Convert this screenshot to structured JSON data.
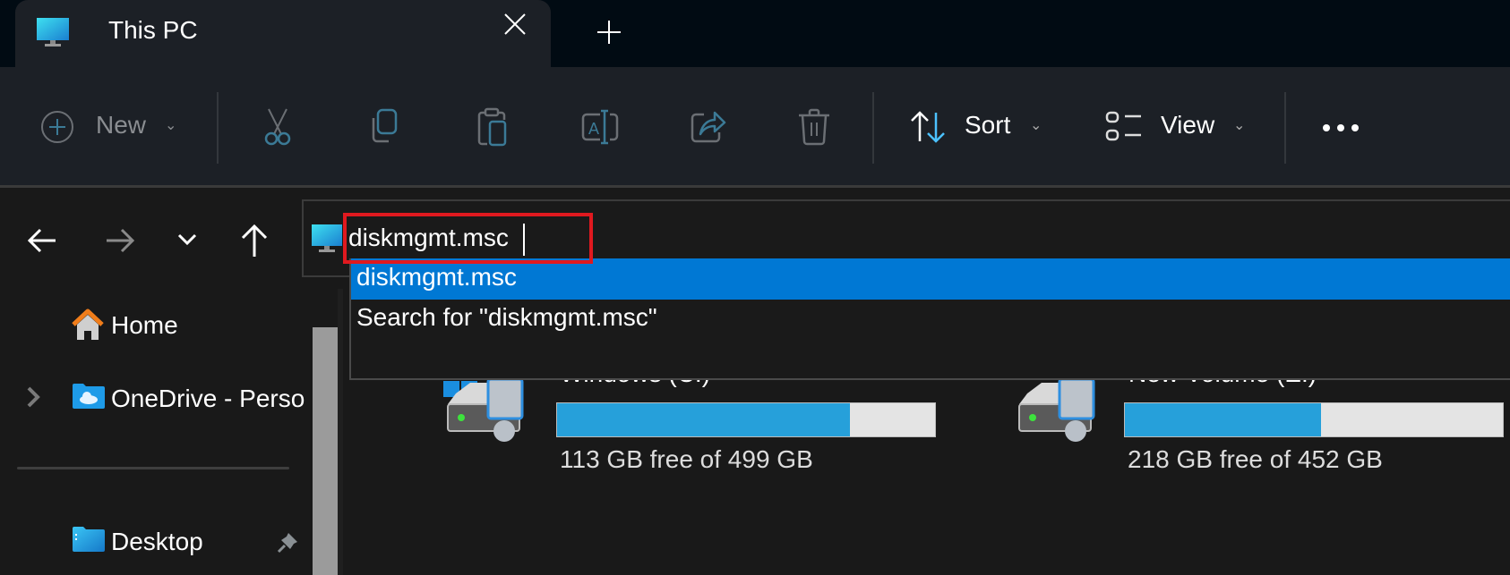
{
  "window": {
    "tab_title": "This PC",
    "tab_icon": "monitor-icon",
    "close_tab_icon": "close-icon",
    "new_tab_icon": "plus-icon"
  },
  "toolbar": {
    "new_label": "New",
    "sort_label": "Sort",
    "view_label": "View",
    "buttons": [
      "new",
      "cut",
      "copy",
      "paste",
      "rename",
      "share",
      "delete",
      "sort",
      "view",
      "more"
    ],
    "accent": "#4cc2ff"
  },
  "nav": {
    "buttons": [
      "back",
      "forward",
      "recent-locations",
      "up"
    ]
  },
  "address_bar": {
    "value": "diskmgmt.msc",
    "highlight_color": "#e0191f"
  },
  "autocomplete": {
    "items": [
      {
        "label": "diskmgmt.msc",
        "selected": true
      },
      {
        "label": "Search for \"diskmgmt.msc\"",
        "selected": false
      }
    ],
    "selected_color": "#0078d4"
  },
  "sidebar": {
    "items": [
      {
        "label": "Home",
        "icon": "home-icon"
      },
      {
        "label": "OneDrive - Perso",
        "icon": "onedrive-folder-icon",
        "expandable": true
      },
      {
        "label": "Desktop",
        "icon": "desktop-folder-icon",
        "pinned": true
      }
    ]
  },
  "drives": [
    {
      "name": "Windows (C:)",
      "free_text": "113 GB free of 499 GB",
      "used_fraction": 0.774,
      "bar_color": "#26a0da"
    },
    {
      "name": "New Volume (E:)",
      "free_text": "218 GB free of 452 GB",
      "used_fraction": 0.518,
      "bar_color": "#26a0da"
    }
  ]
}
